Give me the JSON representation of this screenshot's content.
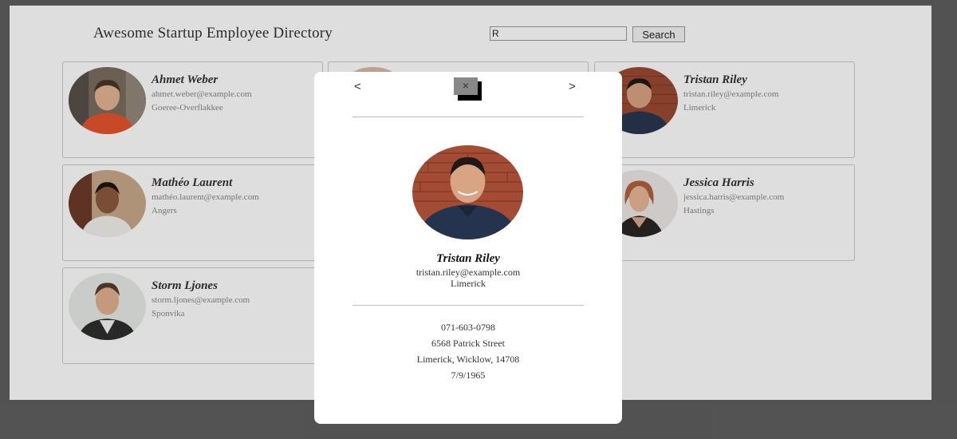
{
  "header": {
    "title": "Awesome Startup Employee Directory"
  },
  "search": {
    "value": "R",
    "button_label": "Search"
  },
  "employees": [
    {
      "name": "Ahmet Weber",
      "email": "ahmet.weber@example.com",
      "location": "Goeree-Overflakkee"
    },
    {
      "name": "Tristan Riley",
      "email": "tristan.riley@example.com",
      "location": "Limerick"
    },
    {
      "name": "Mathéo Laurent",
      "email": "mathéo.laurent@example.com",
      "location": "Angers"
    },
    {
      "name": "Jessica Harris",
      "email": "jessica.harris@example.com",
      "location": "Hastings"
    },
    {
      "name": "Storm Ljones",
      "email": "storm.ljones@example.com",
      "location": "Sponvika"
    }
  ],
  "modal": {
    "prev_label": "<",
    "next_label": ">",
    "close_label": "×",
    "name": "Tristan Riley",
    "email": "tristan.riley@example.com",
    "city": "Limerick",
    "phone": "071-603-0798",
    "street": "6568 Patrick Street",
    "address": "Limerick, Wicklow, 14708",
    "birthday": "7/9/1965"
  },
  "colors": {
    "backdrop": "#5f5f5f",
    "overlay": "rgba(0,0,0,0.13)",
    "card_border": "#c9c9c9"
  }
}
